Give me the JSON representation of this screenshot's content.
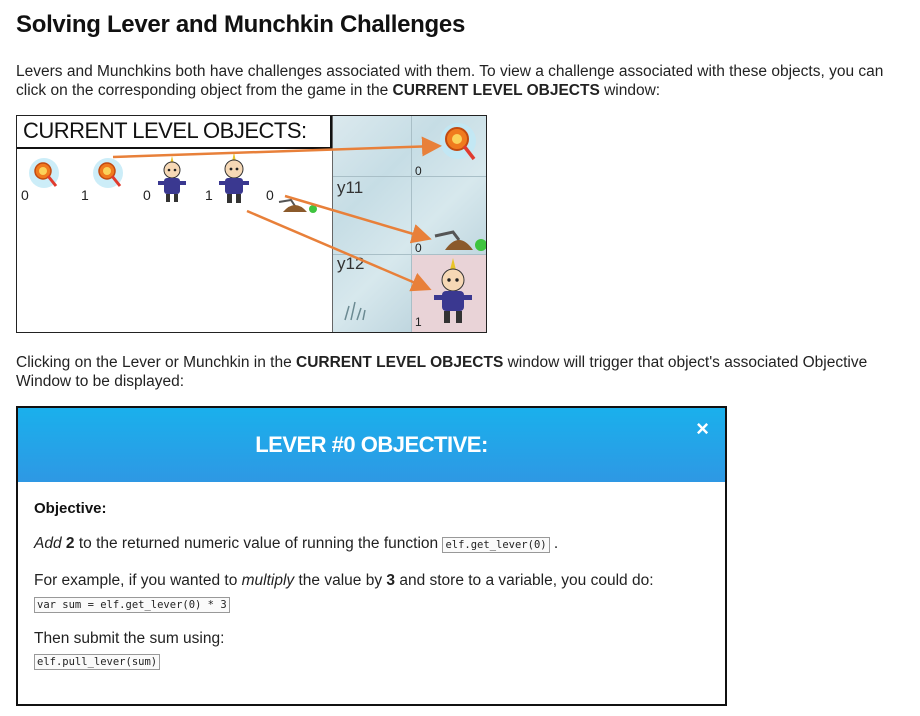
{
  "page": {
    "title": "Solving Lever and Munchkin Challenges",
    "intro": {
      "text1": "Levers and Munchkins both have challenges associated with them. To view a challenge associated with these objects, you can click on the corresponding object from the game in the ",
      "bold": "CURRENT LEVEL OBJECTS",
      "text2": " window:"
    },
    "second": {
      "text1": "Clicking on the Lever or Munchkin in the ",
      "bold": "CURRENT LEVEL OBJECTS",
      "text2": " window will trigger that object's associated Objective Window to be displayed:"
    }
  },
  "game": {
    "panel_title": "CURRENT LEVEL OBJECTS:",
    "objects": [
      {
        "type": "lollipop",
        "index": "0"
      },
      {
        "type": "lollipop",
        "index": "1"
      },
      {
        "type": "munchkin",
        "index": "0"
      },
      {
        "type": "munchkin",
        "index": "1"
      },
      {
        "type": "lever",
        "index": "0"
      }
    ],
    "map": {
      "row_labels": [
        "y11",
        "y12"
      ],
      "tile_numbers": [
        "0",
        "0",
        "1"
      ]
    },
    "arrow_color": "#e8803a"
  },
  "objective_window": {
    "title": "LEVER #0 OBJECTIVE:",
    "close_label": "×",
    "label": "Objective:",
    "line1": {
      "em": "Add",
      "bold": "2",
      "text": " to the returned numeric value of running the function ",
      "code": "elf.get_lever(0)",
      "end": " ."
    },
    "line2": {
      "text1": "For example, if you wanted to ",
      "em": "multiply",
      "text2": " the value by ",
      "bold": "3",
      "text3": " and store to a variable, you could do:",
      "code": "var sum = elf.get_lever(0) * 3"
    },
    "line3": {
      "text": "Then submit the sum using:",
      "code": "elf.pull_lever(sum)"
    }
  },
  "colors": {
    "header_blue": "#1ab0ec",
    "arrow_orange": "#e8803a"
  }
}
